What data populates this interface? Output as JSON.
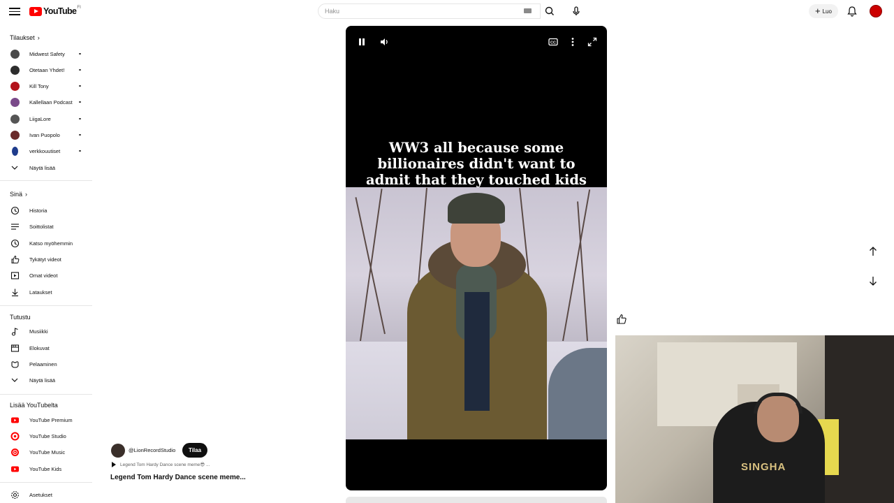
{
  "header": {
    "logo_text": "YouTube",
    "logo_country": "FI",
    "search_placeholder": "Haku",
    "create_label": "Luo",
    "colors": {
      "brand_red": "#ff0000",
      "avatar": "#cc0000"
    }
  },
  "sidebar": {
    "subscriptions_title": "Tilaukset",
    "subscriptions": [
      {
        "label": "Midwest Safety",
        "color": "#4a4a4a"
      },
      {
        "label": "Otetaan Yhdet!",
        "color": "#2d2d2d"
      },
      {
        "label": "Kill Tony",
        "color": "#b3141c"
      },
      {
        "label": "Kallellaan Podcast",
        "color": "#7a4a8a"
      },
      {
        "label": "LiigaLore",
        "color": "#555555"
      },
      {
        "label": "Ivan Puopolo",
        "color": "#6a2a2a"
      },
      {
        "label": "verkkouutiset",
        "color": "#1e3c8c"
      }
    ],
    "show_more_1": "Näytä lisää",
    "you_title": "Sinä",
    "you_items": [
      {
        "label": "Historia",
        "icon": "history-icon"
      },
      {
        "label": "Soittolistat",
        "icon": "playlists-icon"
      },
      {
        "label": "Katso myöhemmin",
        "icon": "watch-later-icon"
      },
      {
        "label": "Tykätyt videot",
        "icon": "liked-icon"
      },
      {
        "label": "Omat videot",
        "icon": "your-videos-icon"
      },
      {
        "label": "Lataukset",
        "icon": "downloads-icon"
      }
    ],
    "explore_title": "Tutustu",
    "explore_items": [
      {
        "label": "Musiikki",
        "icon": "music-icon"
      },
      {
        "label": "Elokuvat",
        "icon": "movies-icon"
      },
      {
        "label": "Pelaaminen",
        "icon": "gaming-icon"
      }
    ],
    "show_more_2": "Näytä lisää",
    "more_title": "Lisää YouTubelta",
    "more_items": [
      {
        "label": "YouTube Premium"
      },
      {
        "label": "YouTube Studio"
      },
      {
        "label": "YouTube Music"
      },
      {
        "label": "YouTube Kids"
      }
    ],
    "settings_label": "Asetukset"
  },
  "video": {
    "caption": "WW3 all because some billionaires didn't want to admit that they touched kids on an island",
    "controls": [
      "pause-icon",
      "volume-icon",
      "captions-icon",
      "more-vert-icon",
      "fullscreen-icon"
    ]
  },
  "channel": {
    "handle": "@LionRecordStudio",
    "subscribe_label": "Tilaa",
    "audio_track": "Legend Tom Hardy Dance scene meme😎 ...",
    "title": "Legend Tom Hardy Dance scene meme..."
  },
  "webcam": {
    "shirt_text": "SINGHA"
  }
}
